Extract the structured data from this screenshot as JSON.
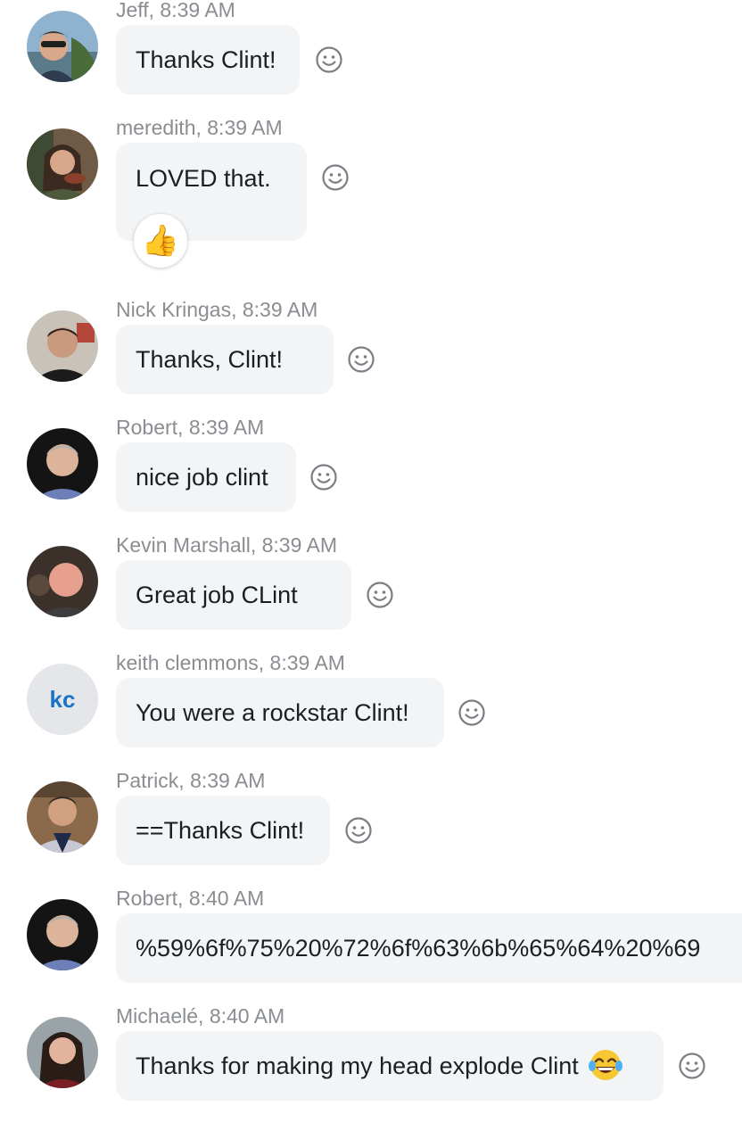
{
  "messages": [
    {
      "author": "Jeff",
      "time": "8:39 AM",
      "meta": "Jeff, 8:39 AM",
      "text": "Thanks Clint!",
      "avatar": "photo-avatar"
    },
    {
      "author": "meredith",
      "time": "8:39 AM",
      "meta": "meredith, 8:39 AM",
      "text": "LOVED that.",
      "avatar": "photo-avatar",
      "reaction": {
        "icon": "thumbs-up-icon",
        "glyph": "👍"
      }
    },
    {
      "author": "Nick Kringas",
      "time": "8:39 AM",
      "meta": "Nick Kringas, 8:39 AM",
      "text": "Thanks, Clint!",
      "avatar": "photo-avatar"
    },
    {
      "author": "Robert",
      "time": "8:39 AM",
      "meta": "Robert, 8:39 AM",
      "text": "nice job clint",
      "avatar": "photo-avatar"
    },
    {
      "author": "Kevin Marshall",
      "time": "8:39 AM",
      "meta": "Kevin Marshall, 8:39 AM",
      "text": "Great job CLint",
      "avatar": "photo-avatar"
    },
    {
      "author": "keith clemmons",
      "time": "8:39 AM",
      "meta": "keith clemmons, 8:39 AM",
      "text": "You were a rockstar Clint!",
      "avatar_initials": "kc"
    },
    {
      "author": "Patrick",
      "time": "8:39 AM",
      "meta": "Patrick, 8:39 AM",
      "text": "==Thanks Clint!",
      "avatar": "photo-avatar"
    },
    {
      "author": "Robert",
      "time": "8:40 AM",
      "meta": "Robert, 8:40 AM",
      "text": "%59%6f%75%20%72%6f%63%6b%65%64%20%69",
      "avatar": "photo-avatar"
    },
    {
      "author": "Michaelé",
      "time": "8:40 AM",
      "meta": "Michaelé, 8:40 AM",
      "text": "Thanks for making my head explode Clint",
      "avatar": "photo-avatar",
      "inline_emoji": "laughing-tears-emoji-icon"
    }
  ],
  "icons": {
    "add_reaction": "smiley-face-icon"
  },
  "colors": {
    "bubble_bg": "#f2f4f6",
    "meta_text": "#8a8d91",
    "message_text": "#1c1e21",
    "initials_text": "#1a73c8",
    "initials_bg": "#e4e6ea"
  }
}
